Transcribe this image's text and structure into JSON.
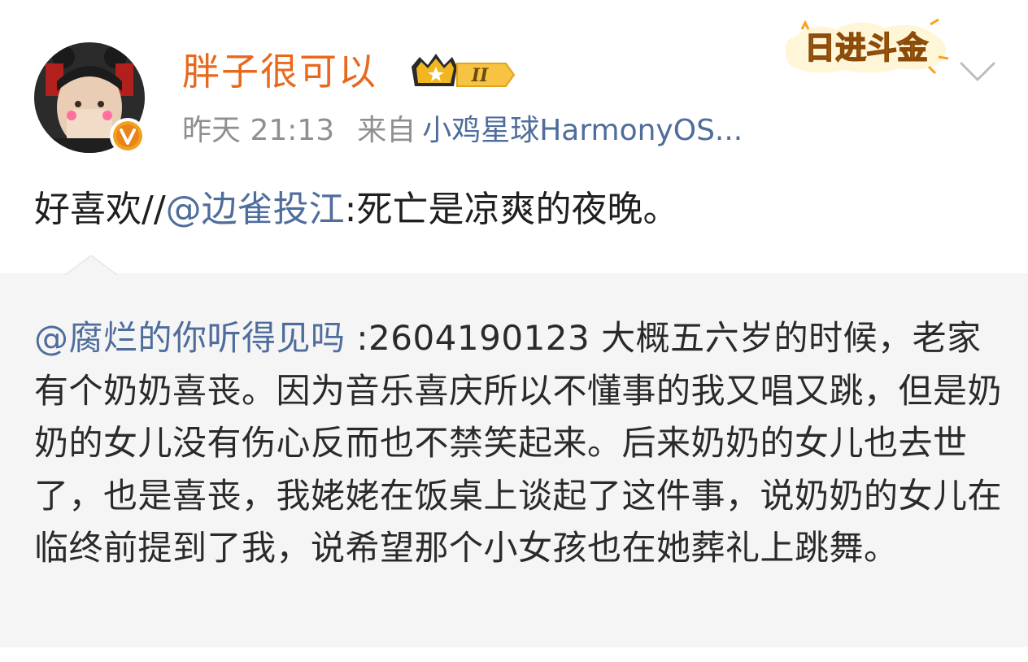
{
  "post": {
    "username": "胖子很可以",
    "member_level": "II",
    "time": "昨天 21:13",
    "source_prefix": "来自",
    "source_name": "小鸡星球HarmonyOS...",
    "text_before": "好喜欢//",
    "mention": "@边雀投江",
    "text_after": ":死亡是凉爽的夜晚。"
  },
  "sticker": {
    "text": "日进斗金"
  },
  "retweet": {
    "mention": "@腐烂的你听得见吗",
    "text": " :2604190123 大概五六岁的时候，老家有个奶奶喜丧。因为音乐喜庆所以不懂事的我又唱又跳，但是奶奶的女儿没有伤心反而也不禁笑起来。后来奶奶的女儿也去世了，也是喜丧，我姥姥在饭桌上谈起了这件事，说奶奶的女儿在临终前提到了我，说希望那个小女孩也在她葬礼上跳舞。"
  },
  "colors": {
    "username": "#e8691d",
    "link": "#4f6d9c",
    "meta": "#8f8f8f",
    "retweet_bg": "#f5f5f5"
  },
  "icons": [
    "avatar-icon",
    "verified-badge-icon",
    "member-crown-icon",
    "sticker-icon",
    "chevron-down-icon"
  ]
}
